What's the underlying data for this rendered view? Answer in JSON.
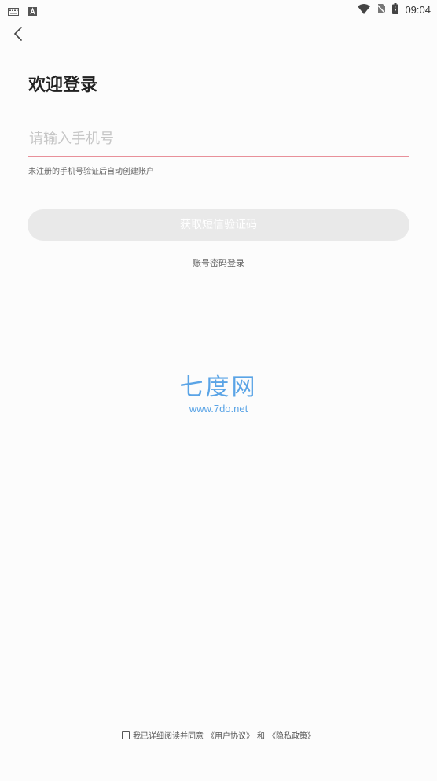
{
  "status_bar": {
    "time": "09:04",
    "icons": [
      "keyboard-icon",
      "a-icon",
      "wifi-icon",
      "no-sim-icon",
      "battery-icon"
    ]
  },
  "header": {
    "back_icon": "chevron-left-icon",
    "title": "欢迎登录"
  },
  "form": {
    "phone_placeholder": "请输入手机号",
    "phone_value": "",
    "hint": "未注册的手机号验证后自动创建账户",
    "sms_button": "获取短信验证码",
    "password_login_link": "账号密码登录"
  },
  "watermark": {
    "name": "七度网",
    "url": "www.7do.net"
  },
  "agreement": {
    "prefix": "我已详细阅读并同意",
    "user_agreement": "《用户协议》",
    "and": "和",
    "privacy_policy": "《隐私政策》"
  },
  "colors": {
    "accent_underline": "#e8909a",
    "button_disabled": "#e9e9e9",
    "watermark": "#5aa4e6"
  }
}
